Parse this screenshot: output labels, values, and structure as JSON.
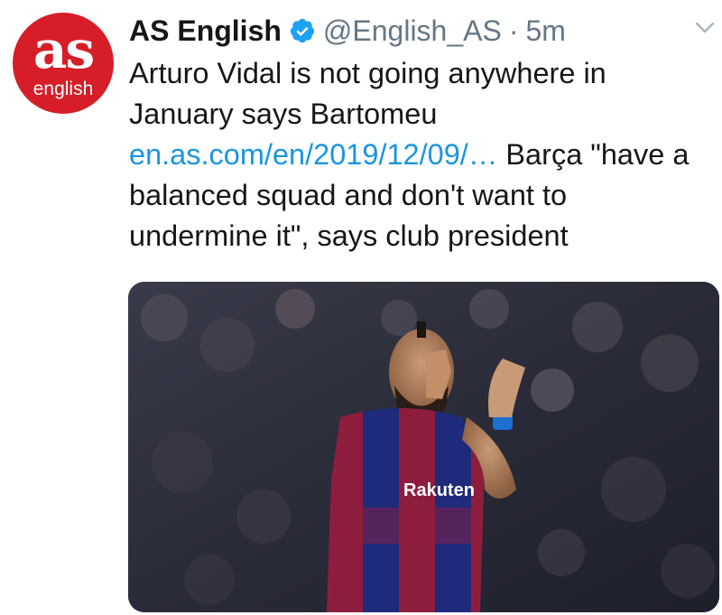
{
  "tweet": {
    "avatar": {
      "logo_text": "as",
      "logo_subtext": "english"
    },
    "author": {
      "display_name": "AS English",
      "handle": "@English_AS",
      "separator": "·",
      "timestamp": "5m",
      "verified": true
    },
    "text_parts": {
      "part1": "Arturo Vidal is not going anywhere in January says Bartomeu ",
      "link": "en.as.com/en/2019/12/09/…",
      "part2": " Barça \"have a balanced squad and don't want to undermine it\", says club president"
    },
    "media": {
      "kind": "photo",
      "shirt_sponsor": "Rakuten"
    },
    "icons": [
      "verified-badge-icon",
      "chevron-down-icon"
    ]
  },
  "colors": {
    "brand_red": "#d71e28",
    "verified_blue": "#1da1f2",
    "link_blue": "#1b95e0",
    "secondary_text": "#657786"
  }
}
